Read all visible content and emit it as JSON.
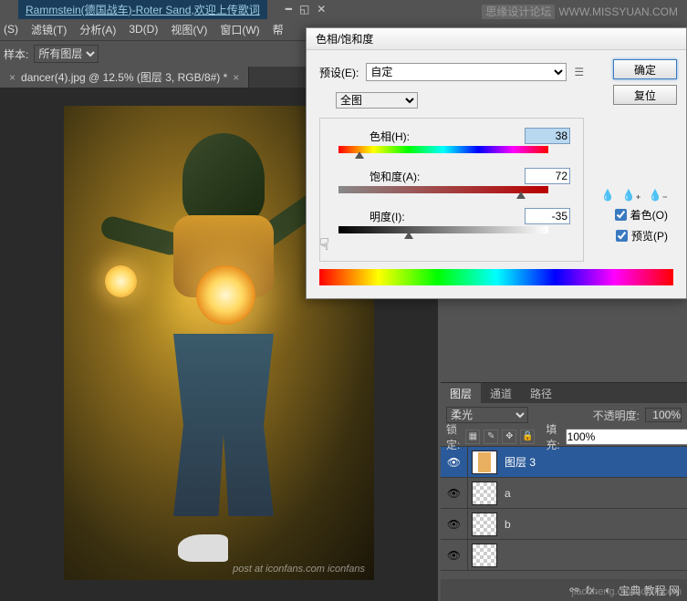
{
  "window": {
    "title": "Rammstein(德国战车)-Roter Sand,欢迎上传歌词",
    "forum_name": "思缘设计论坛",
    "forum_url": "WWW.MISSYUAN.COM"
  },
  "menu": {
    "items": [
      "(S)",
      "滤镜(T)",
      "分析(A)",
      "3D(D)",
      "视图(V)",
      "窗口(W)",
      "帮"
    ]
  },
  "options": {
    "sample_label": "样本:",
    "sample_value": "所有图层"
  },
  "document": {
    "tab_title": "dancer(4).jpg @ 12.5% (图层 3, RGB/8#) *",
    "watermark": "post at iconfans.com  iconfans"
  },
  "dialog": {
    "title": "色相/饱和度",
    "preset_label": "预设(E):",
    "preset_value": "自定",
    "master_value": "全图",
    "hue_label": "色相(H):",
    "hue_value": "38",
    "sat_label": "饱和度(A):",
    "sat_value": "72",
    "light_label": "明度(I):",
    "light_value": "-35",
    "colorize_label": "着色(O)",
    "preview_label": "预览(P)",
    "ok": "确定",
    "reset": "复位"
  },
  "layers_panel": {
    "tabs": [
      "图层",
      "通道",
      "路径"
    ],
    "blend_mode": "柔光",
    "opacity_label": "不透明度:",
    "opacity_value": "100%",
    "lock_label": "锁定:",
    "fill_label": "填充:",
    "fill_value": "100%",
    "layers": [
      {
        "name": "图层 3",
        "selected": true
      },
      {
        "name": "a",
        "selected": false
      },
      {
        "name": "b",
        "selected": false
      }
    ],
    "footer_text": "宝典 教程 网"
  },
  "page_watermark": "jiaocheng.chazidian.com"
}
